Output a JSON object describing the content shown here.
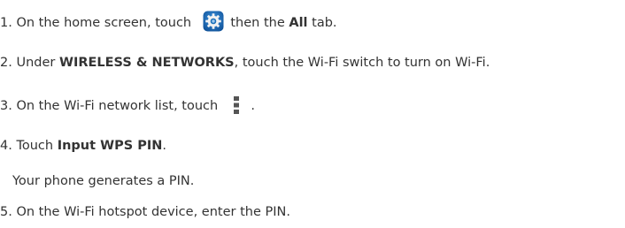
{
  "steps": [
    {
      "number": "1.",
      "before": "On the home screen, touch",
      "icon": "settings-gear-icon",
      "after": "then the",
      "bold": "All",
      "end": "tab."
    },
    {
      "number": "2.",
      "before": "Under",
      "bold": "WIRELESS & NETWORKS",
      "after": ", touch the Wi-Fi switch to turn on Wi-Fi."
    },
    {
      "number": "3.",
      "before": "On the Wi-Fi network list, touch",
      "icon": "menu-more-icon",
      "after": "."
    },
    {
      "number": "4.",
      "before": "Touch",
      "bold": "Input WPS PIN",
      "after": "."
    },
    {
      "note": "Your phone generates a PIN."
    },
    {
      "number": "5.",
      "before": "On the Wi-Fi hotspot device, enter the PIN."
    }
  ],
  "colors": {
    "text": "#333333",
    "icon_blue": "#1b6fb8",
    "icon_dark": "#555555"
  }
}
